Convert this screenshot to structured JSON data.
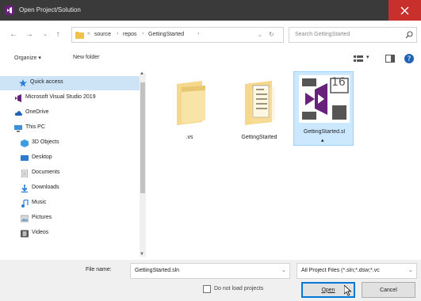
{
  "window": {
    "title": "Open Project/Solution"
  },
  "address_bar": {
    "crumbs": [
      "source",
      "repos",
      "GettingStarted"
    ]
  },
  "search": {
    "placeholder": "Search GettingStarted"
  },
  "toolbar": {
    "organize_label": "Organize ▾",
    "new_folder_label": "New folder"
  },
  "nav_pane": {
    "items": [
      {
        "label": "Quick access",
        "icon": "star-icon"
      },
      {
        "label": "Microsoft Visual Studio 2019",
        "icon": "visual-studio-icon"
      },
      {
        "label": "OneDrive",
        "icon": "cloud-icon"
      },
      {
        "label": "This PC",
        "icon": "computer-icon"
      },
      {
        "label": "3D Objects",
        "icon": "cube-icon"
      },
      {
        "label": "Desktop",
        "icon": "desktop-icon"
      },
      {
        "label": "Documents",
        "icon": "document-icon"
      },
      {
        "label": "Downloads",
        "icon": "download-icon"
      },
      {
        "label": "Music",
        "icon": "music-icon"
      },
      {
        "label": "Pictures",
        "icon": "picture-icon"
      },
      {
        "label": "Videos",
        "icon": "video-icon"
      }
    ]
  },
  "files": [
    {
      "name": ".vs",
      "icon": "folder-icon"
    },
    {
      "name": "GettingStarted",
      "icon": "folder-with-files-icon"
    },
    {
      "name": "GettingStarted.sl",
      "icon": "visual-studio-solution-icon",
      "badge": "16"
    }
  ],
  "footer": {
    "file_name_label": "File name:",
    "file_name_value": "GettingStarted.sln",
    "filter_value": "All Project Files (*.sln;*.dsw;*.vc",
    "do_not_load_label": "Do not load projects",
    "open_label": "Open",
    "cancel_label": "Cancel"
  },
  "colors": {
    "titlebar": "#3a3a3a",
    "close": "#c9302c",
    "selection": "#cce8ff",
    "vs_purple": "#68217a",
    "accent": "#0078d7"
  }
}
